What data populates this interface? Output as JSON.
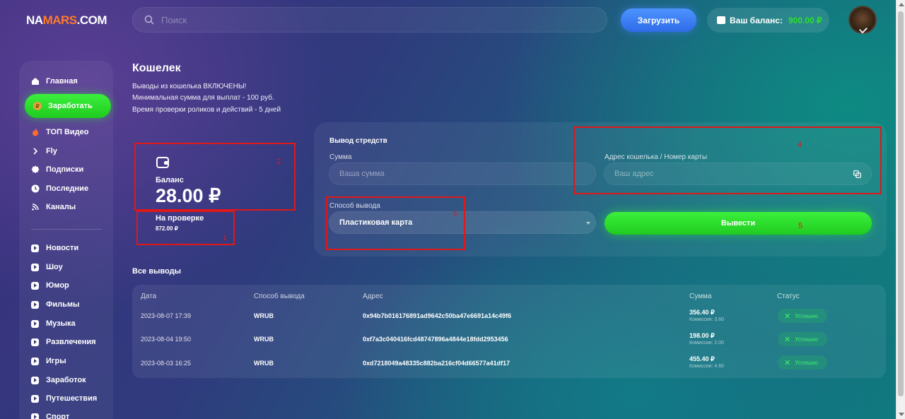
{
  "header": {
    "logo_a": "NA",
    "logo_b": "MARS",
    "logo_c": ".COM",
    "search_placeholder": "Поиск",
    "upload_label": "Загрузить",
    "balance_label": "Ваш баланс:",
    "balance_value": "900.00 ₽"
  },
  "sidebar": {
    "main": [
      {
        "label": "Главная",
        "icon": "home-icon"
      },
      {
        "label": "Заработать",
        "icon": "coin-icon"
      },
      {
        "label": "ТОП Видео",
        "icon": "fire-icon"
      },
      {
        "label": "Fly",
        "icon": "chevron-right-icon"
      },
      {
        "label": "Подписки",
        "icon": "badge-icon"
      },
      {
        "label": "Последние",
        "icon": "clock-icon"
      },
      {
        "label": "Каналы",
        "icon": "broadcast-icon"
      }
    ],
    "categories": [
      "Новости",
      "Шоу",
      "Юмор",
      "Фильмы",
      "Музыка",
      "Развлечения",
      "Игры",
      "Заработок",
      "Путешествия",
      "Спорт"
    ]
  },
  "page": {
    "title": "Кошелек",
    "info": [
      "Выводы из кошелька ВКЛЮЧЕНЫ!",
      "Минимальная сумма для выплат - 100 руб.",
      "Время проверки роликов и действий - 5 дней"
    ]
  },
  "balance": {
    "label": "Баланс",
    "value": "28.00 ₽",
    "pending_label": "На проверке",
    "pending_value": "872.00 ₽"
  },
  "withdraw": {
    "title": "Вывод стредств",
    "amount_label": "Сумма",
    "amount_placeholder": "Ваша сумма",
    "address_label": "Адрес кошелька / Номер карты",
    "address_placeholder": "Ваш адрес",
    "method_label": "Способ вывода",
    "method_value": "Пластиковая карта",
    "submit_label": "Вывести"
  },
  "annotations": [
    "1",
    "2",
    "3",
    "4",
    "5"
  ],
  "history": {
    "title": "Все выводы",
    "columns": [
      "Дата",
      "Способ вывода",
      "Адрес",
      "Сумма",
      "Статус"
    ],
    "rows": [
      {
        "date": "2023-08-07 17:39",
        "method": "WRUB",
        "address": "0x94b7b016176891ad9642c50ba47e6691a14c49f6",
        "sum": "356.40 ₽",
        "fee": "Комиссия: 3.60",
        "status": "Успешно"
      },
      {
        "date": "2023-08-04 19:50",
        "method": "WRUB",
        "address": "0xf7a3c040416fcd48747896a4844e18fdd2953456",
        "sum": "198.00 ₽",
        "fee": "Комиссия: 2.00",
        "status": "Успешно"
      },
      {
        "date": "2023-08-03 16:25",
        "method": "WRUB",
        "address": "0xd7218049a48335c882ba216cf04d66577a41df17",
        "sum": "455.40 ₽",
        "fee": "Комиссия: 4.60",
        "status": "Успешно"
      }
    ]
  },
  "colors": {
    "accent_green": "#2fe02f",
    "accent_blue": "#3f80f5",
    "annotation_red": "#e01818"
  }
}
